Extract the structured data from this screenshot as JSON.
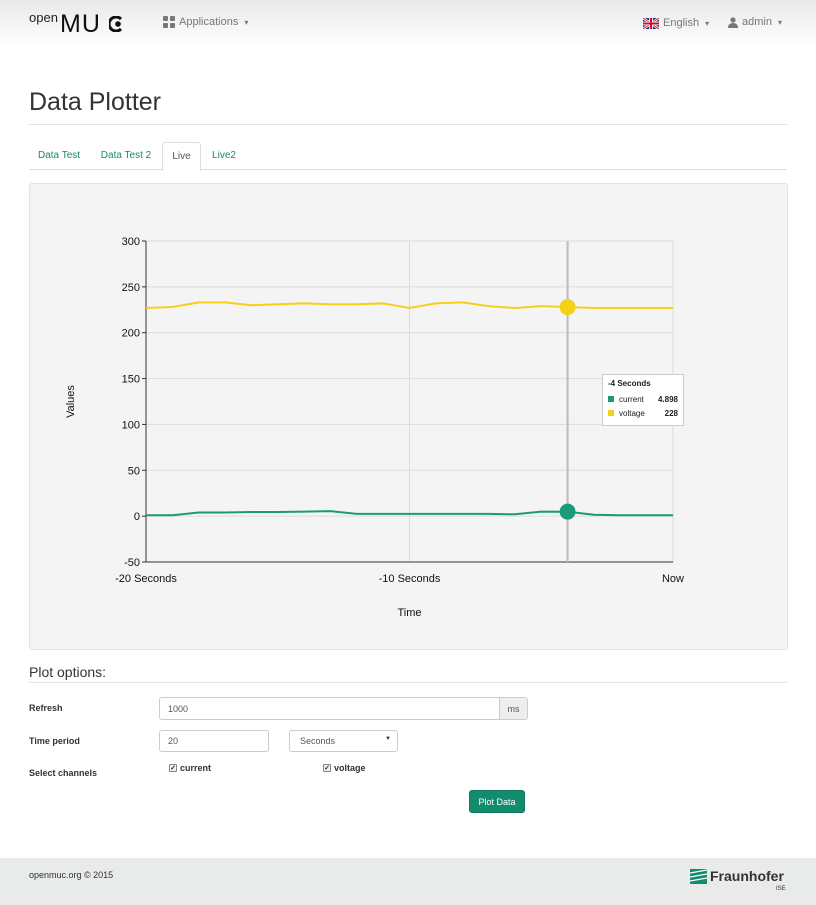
{
  "navbar": {
    "brand_small": "open",
    "brand_large": "MU",
    "applications_label": "Applications",
    "language_label": "English",
    "user_label": "admin"
  },
  "page": {
    "title": "Data Plotter"
  },
  "tabs": [
    {
      "label": "Data Test"
    },
    {
      "label": "Data Test 2"
    },
    {
      "label": "Live"
    },
    {
      "label": "Live2"
    }
  ],
  "active_tab": "Live",
  "chart_data": {
    "type": "line",
    "title": "",
    "xlabel": "Time",
    "ylabel": "Values",
    "x_ticks": [
      "-20 Seconds",
      "-10 Seconds",
      "Now"
    ],
    "y_ticks": [
      300,
      250,
      200,
      150,
      100,
      50,
      0,
      -50
    ],
    "xlim": [
      -20,
      0
    ],
    "ylim": [
      -50,
      300
    ],
    "grid": true,
    "x": [
      -20,
      -19,
      -18,
      -17,
      -16,
      -15,
      -14,
      -13,
      -12,
      -11,
      -10,
      -9,
      -8,
      -7,
      -6,
      -5,
      -4,
      -3,
      -2,
      -1,
      0
    ],
    "series": [
      {
        "name": "voltage",
        "color": "#f5d019",
        "values": [
          227,
          228,
          233,
          233,
          230,
          231,
          232,
          231,
          231,
          232,
          227,
          232,
          233,
          229,
          227,
          229,
          228,
          227,
          227,
          227,
          227
        ]
      },
      {
        "name": "current",
        "color": "#1b9a77",
        "values": [
          1,
          1,
          4,
          4,
          4.5,
          4.5,
          5,
          5.5,
          2.5,
          2.5,
          2.5,
          2.5,
          2.5,
          2.5,
          2,
          5,
          4.898,
          1.5,
          1,
          1,
          1
        ]
      }
    ],
    "hover": {
      "x": -4,
      "title": "-4 Seconds",
      "rows": [
        {
          "name": "current",
          "value": "4.898",
          "color": "#1b9a77"
        },
        {
          "name": "voltage",
          "value": "228",
          "color": "#f5d019"
        }
      ]
    }
  },
  "plot_options": {
    "title": "Plot options:",
    "refresh_label": "Refresh",
    "refresh_value": "1000",
    "refresh_unit": "ms",
    "time_period_label": "Time period",
    "time_period_value": "20",
    "time_unit": "Seconds",
    "channels_label": "Select channels",
    "channels": [
      {
        "name": "current",
        "checked": true
      },
      {
        "name": "voltage",
        "checked": true
      }
    ],
    "plot_button": "Plot Data"
  },
  "footer": {
    "copyright": "openmuc.org © 2015",
    "logo_name": "Fraunhofer",
    "logo_sub": "ISE"
  },
  "colors": {
    "accent": "#138c6e"
  }
}
